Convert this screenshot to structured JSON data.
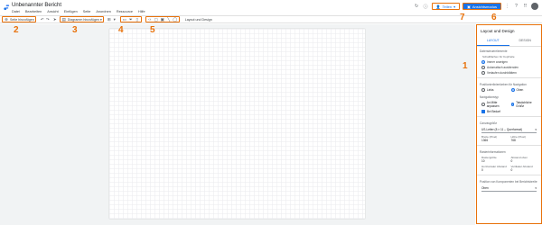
{
  "app": {
    "title": "Unbenannter Bericht"
  },
  "menu": [
    "Datei",
    "Bearbeiten",
    "Ansicht",
    "Einfügen",
    "Seite",
    "Anordnen",
    "Ressource",
    "Hilfe"
  ],
  "topbar": {
    "share_label": "Teilen",
    "view_label": "Ansichtsmodus"
  },
  "toolbar": {
    "add_page": "Seite hinzufügen",
    "add_chart": "Diagramm hinzufügen",
    "layout_label": "Layout und Design"
  },
  "panel": {
    "title": "Layout und Design",
    "tabs": [
      "LAYOUT",
      "DESIGN"
    ],
    "sec1": "Datensteuerelemente",
    "sub1": "Schaltflächen für Kopfzeile",
    "opt1": [
      "Immer anzeigen",
      "Automatisch ausblenden",
      "Verlaufen durchblättern"
    ],
    "sec2": "Positionierlinienfarben für Navigation",
    "opt2": [
      "Links",
      "Oben"
    ],
    "sec3": "Navigationstyp",
    "opt3": [
      "An Mitte anpassen",
      "Tatsächliche Größe"
    ],
    "check": "Bei Bedarf",
    "sec4": "Canvasgröße",
    "size_select": "US-Letter (8 × 11 – Querformat)",
    "width_label": "Breite (Pixel)",
    "width_val": "1366",
    "height_label": "Höhe (Pixel)",
    "height_val": "768",
    "sec5": "Rasterinformationen",
    "grid1_label": "Rastergröße",
    "grid1_val": "10",
    "grid2_label": "Abstand oben",
    "grid2_val": "0",
    "grid3_label": "Horizontaler Abstand",
    "grid3_val": "0",
    "grid4_label": "Vertikaler Abstand",
    "grid4_val": "0",
    "sec6": "Position von Komponenten bei Berichtsbreite",
    "pos_select": "Oben"
  },
  "markers": [
    "1",
    "2",
    "3",
    "4",
    "5",
    "6",
    "7"
  ],
  "colors": {
    "accent": "#1a73e8",
    "marker": "#e8710a"
  }
}
